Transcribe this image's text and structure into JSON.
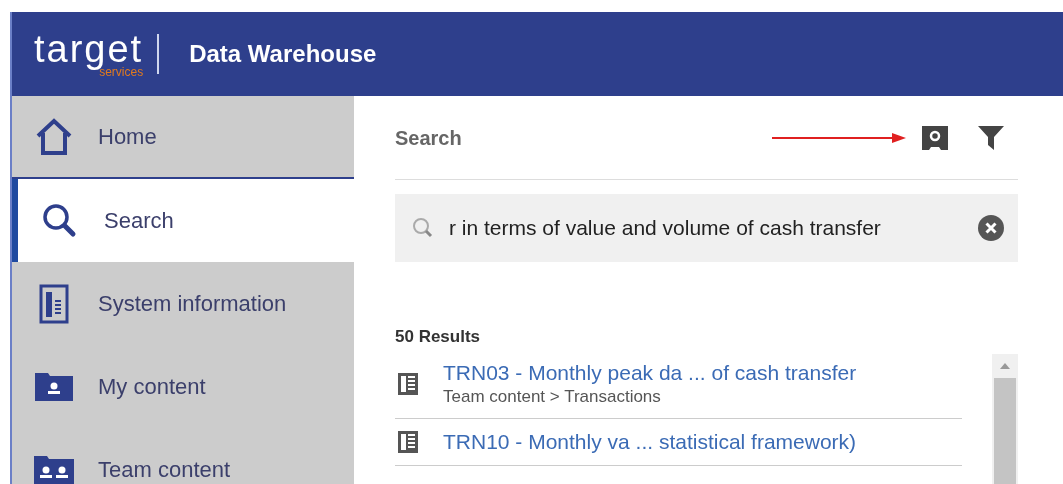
{
  "header": {
    "logo": "target",
    "logo_sub": "services",
    "title": "Data Warehouse"
  },
  "sidebar": {
    "items": [
      {
        "label": "Home",
        "selected": false
      },
      {
        "label": "Search",
        "selected": true
      },
      {
        "label": "System information",
        "selected": false
      },
      {
        "label": "My content",
        "selected": false
      },
      {
        "label": "Team content",
        "selected": false
      }
    ]
  },
  "panel": {
    "title": "Search",
    "search": {
      "value": "r in terms of value and volume of cash transfer"
    },
    "results_count": "50 Results",
    "results": [
      {
        "title": "TRN03 - Monthly peak da ... of cash transfer",
        "path": "Team content > Transactions"
      },
      {
        "title": "TRN10 - Monthly va ... statistical framework)"
      }
    ]
  }
}
